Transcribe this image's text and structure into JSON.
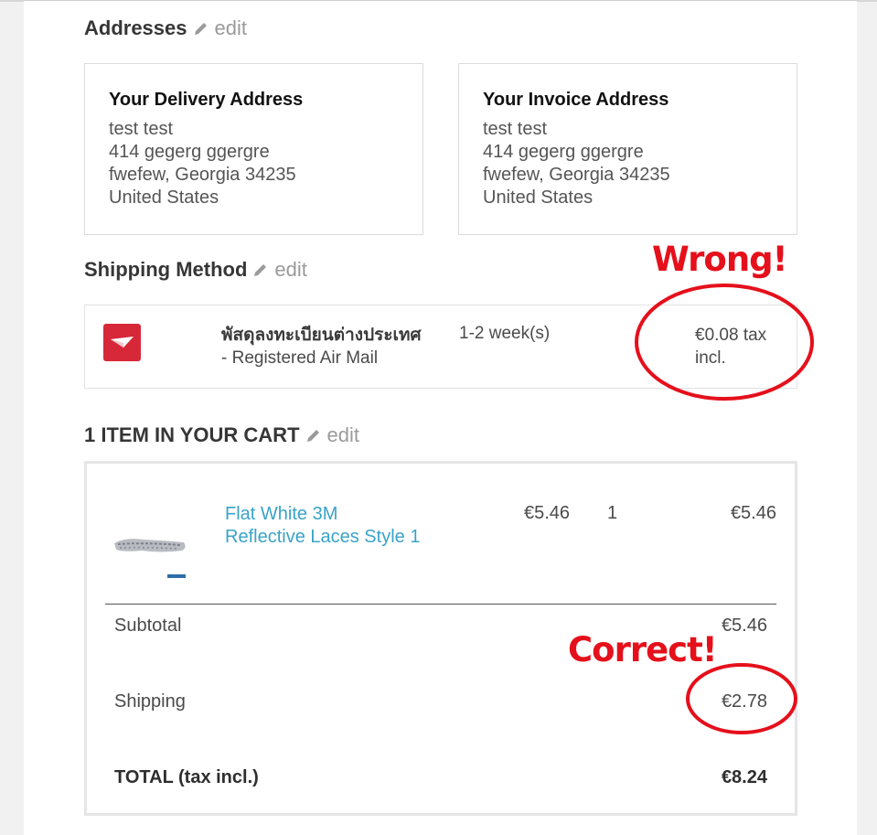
{
  "addresses": {
    "title": "Addresses",
    "edit_label": "edit",
    "delivery": {
      "heading": "Your Delivery Address",
      "lines": [
        "test test",
        "414 gegerg ggergre",
        "fwefew, Georgia 34235",
        "United States"
      ]
    },
    "invoice": {
      "heading": "Your Invoice Address",
      "lines": [
        "test test",
        "414 gegerg ggergre",
        "fwefew, Georgia 34235",
        "United States"
      ]
    }
  },
  "shipping_method": {
    "title": "Shipping Method",
    "edit_label": "edit",
    "carrier_name_thai": "พัสดุลงทะเบียนต่างประเทศ",
    "carrier_name_en": "- Registered Air Mail",
    "delay": "1-2 week(s)",
    "price_line1": "€0.08 tax",
    "price_line2": "incl."
  },
  "cart": {
    "title": "1 ITEM IN YOUR CART",
    "edit_label": "edit",
    "product": {
      "name_line1": "Flat White 3M",
      "name_line2": "Reflective Laces Style 1",
      "unit_price": "€5.46",
      "quantity": "1",
      "total": "€5.46"
    },
    "subtotal_label": "Subtotal",
    "subtotal_value": "€5.46",
    "shipping_label": "Shipping",
    "shipping_value": "€2.78",
    "total_label": "TOTAL (tax incl.)",
    "total_value": "€8.24"
  },
  "annotations": {
    "wrong": "Wrong!",
    "correct": "Correct!",
    "color": "#e5101b"
  },
  "colors": {
    "link": "#3aa3c8",
    "carrier_logo": "#d7283a"
  },
  "icons": {
    "edit": "pencil-icon",
    "carrier": "carrier-logo-icon",
    "product": "product-image"
  }
}
